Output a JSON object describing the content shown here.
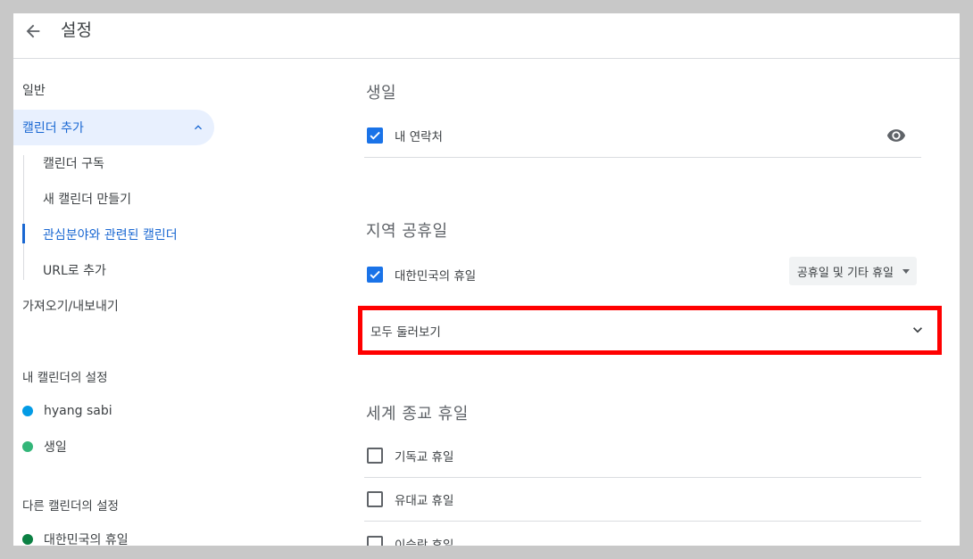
{
  "header": {
    "title": "설정"
  },
  "sidebar": {
    "general": "일반",
    "add_calendar": "캘린더 추가",
    "sub_items": [
      "캘린더 구독",
      "새 캘린더 만들기",
      "관심분야와 관련된 캘린더",
      "URL로 추가"
    ],
    "import_export": "가져오기/내보내기",
    "my_calendars_label": "내 캘린더의 설정",
    "my_calendars": [
      {
        "name": "hyang sabi",
        "color": "#039be5"
      },
      {
        "name": "생일",
        "color": "#33b679"
      }
    ],
    "other_calendars_label": "다른 캘린더의 설정",
    "other_calendars": [
      {
        "name": "대한민국의 휴일",
        "color": "#0b8043"
      }
    ]
  },
  "main": {
    "birthday": {
      "title": "생일",
      "contacts_label": "내 연락처",
      "checked": true
    },
    "regional": {
      "title": "지역 공휴일",
      "korea_label": "대한민국의 휴일",
      "checked": true,
      "select_value": "공휴일 및 기타 휴일",
      "browse_all": "모두 둘러보기"
    },
    "religious": {
      "title": "세계 종교 휴일",
      "items": [
        "기독교 휴일",
        "유대교 휴일",
        "이슬람 휴일"
      ]
    }
  },
  "colors": {
    "accent": "#1a73e8",
    "active_nav_bg": "#e8f0fe",
    "highlight_border": "#ff0000"
  }
}
